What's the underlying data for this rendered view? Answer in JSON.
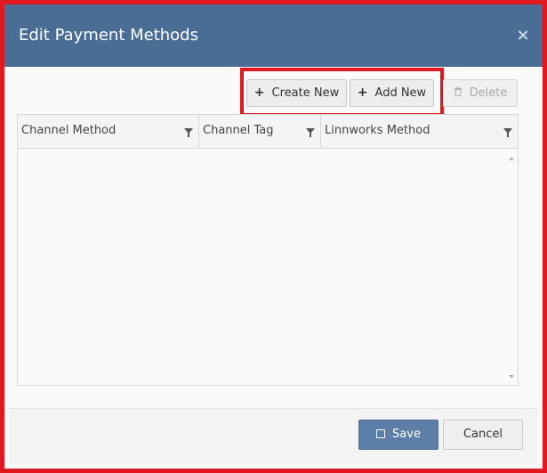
{
  "dialog": {
    "title": "Edit Payment Methods",
    "close_glyph": "×"
  },
  "toolbar": {
    "create_new_label": "Create New",
    "add_new_label": "Add New",
    "delete_label": "Delete",
    "plus_glyph": "+"
  },
  "grid": {
    "columns": [
      {
        "label": "Channel Method"
      },
      {
        "label": "Channel Tag"
      },
      {
        "label": "Linnworks Method"
      }
    ],
    "rows": []
  },
  "footer": {
    "save_label": "Save",
    "cancel_label": "Cancel"
  },
  "colors": {
    "header_bg": "#4a6d95",
    "highlight": "#e0181f",
    "save_bg": "#5d7ea6"
  }
}
